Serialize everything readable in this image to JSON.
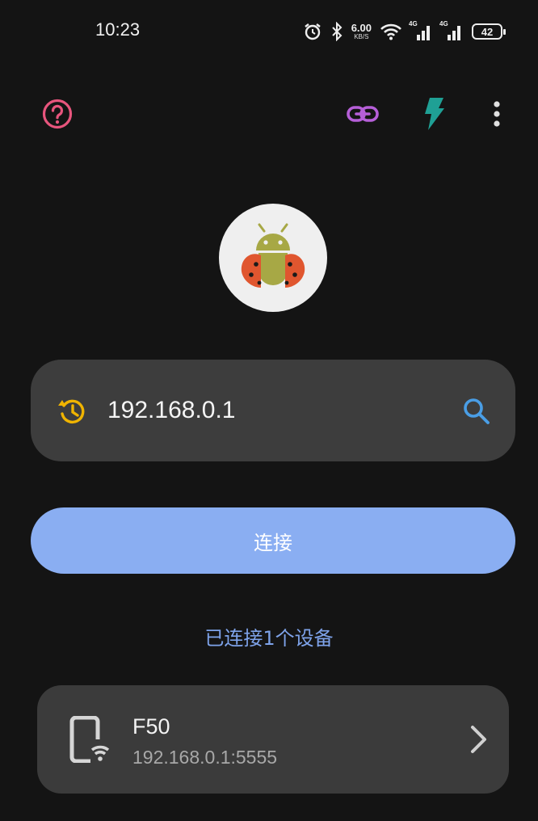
{
  "status_bar": {
    "time": "10:23",
    "net_speed_value": "6.00",
    "net_speed_unit": "KB/S",
    "sim1_label": "4G",
    "sim2_label": "4G",
    "battery_level": "42",
    "icons": [
      "alarm-icon",
      "bluetooth-icon",
      "wifi-icon",
      "signal-icon",
      "signal-icon",
      "battery-icon"
    ]
  },
  "toolbar": {
    "help_icon": "help-icon",
    "link_icon": "link-icon",
    "flash_icon": "flash-icon",
    "more_icon": "more-vert-icon"
  },
  "search": {
    "value": "192.168.0.1",
    "history_icon": "history-icon",
    "search_icon": "search-icon"
  },
  "connect": {
    "label": "连接"
  },
  "connected_count": "已连接1个设备",
  "devices": [
    {
      "name": "F50",
      "address": "192.168.0.1:5555"
    }
  ],
  "colors": {
    "background": "#141414",
    "surface": "#3d3d3d",
    "primary": "#8aaef2",
    "accent_text": "#7ea3ea",
    "help": "#e8557d",
    "link": "#b65fd8",
    "flash": "#1fa095",
    "history": "#f0b400",
    "search": "#4a9ee6"
  }
}
